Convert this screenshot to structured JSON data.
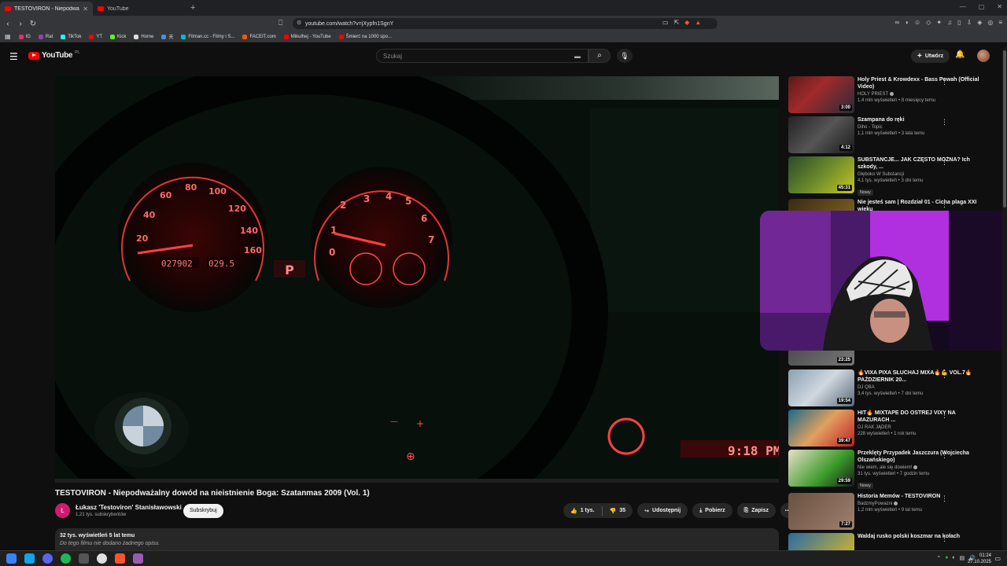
{
  "browser": {
    "tabs": [
      {
        "label": "TESTOVIRON - Niepodważaln",
        "active": true
      },
      {
        "label": "YouTube",
        "active": false
      }
    ],
    "url": "youtube.com/watch?v=jXypfn1SgnY",
    "bookmarks": [
      {
        "label": "IG",
        "color": "#e1306c"
      },
      {
        "label": "Rat",
        "color": "#8e44ad"
      },
      {
        "label": "TikTok",
        "color": "#25f4ee"
      },
      {
        "label": "YT",
        "color": "#ff0000"
      },
      {
        "label": "Kick",
        "color": "#53fc18"
      },
      {
        "label": "Home",
        "color": "#dddddd"
      },
      {
        "label": "天",
        "color": "#4a90d9"
      },
      {
        "label": "Filman.cc - Filmy i S...",
        "color": "#00bcd4"
      },
      {
        "label": "FACEIT.com",
        "color": "#ff5500"
      },
      {
        "label": "Mikulhej - YouTube",
        "color": "#ff0000"
      },
      {
        "label": "Śmierć na 1000 spo...",
        "color": "#ff0000"
      }
    ]
  },
  "header": {
    "logo": "YouTube",
    "country": "PL",
    "search_placeholder": "Szukaj",
    "create_label": "Utwórz"
  },
  "video": {
    "title": "TESTOVIRON - Niepodważalny dowód na nieistnienie Boga: Szatanmas 2009 (Vol. 1)",
    "channel": "Łukasz 'Testoviron' Stanisławowski",
    "channel_initial": "Ł",
    "subscribers": "1,21 tys. subskrybentów",
    "subscribe_label": "Subskrybuj",
    "likes": "1 tys.",
    "dislikes": "35",
    "share_label": "Udostępnij",
    "download_label": "Pobierz",
    "save_label": "Zapisz",
    "views_meta": "32 tys. wyświetleń  5 lat temu",
    "description": "Do tego filmu nie dodano żadnego opisu.",
    "odometer": "027902",
    "trip": "029.5",
    "gear": "P",
    "clock": "9:18 PM"
  },
  "sidebar": {
    "items": [
      {
        "title": "Holy Priest & Krowdexx - Bass Powah (Official Video)",
        "channel": "HOLY PRIEST",
        "meta": "1,4 mln wyświetleń • 8 miesięcy temu",
        "duration": "3:00",
        "new": ""
      },
      {
        "title": "Szampana do ręki",
        "channel": "Diho - Topic",
        "meta": "1,1 mln wyświetleń • 3 lata temu",
        "duration": "4:12",
        "new": ""
      },
      {
        "title": "SUBSTANCJE... JAK CZĘSTO MOŻNA? Ich szkody, ...",
        "channel": "Głęboko W Substancji",
        "meta": "4,1 tys. wyświetleń • 3 dni temu",
        "duration": "45:31",
        "new": "Nowy"
      },
      {
        "title": "Nie jesteś sam | Rozdział 01 - Cicha plaga XXI wieku",
        "channel": "",
        "meta": "",
        "duration": "",
        "new": ""
      },
      {
        "title": "",
        "channel": "",
        "meta": "",
        "duration": "23:25",
        "new": ""
      },
      {
        "title": "🔥VIXA PIXA SŁUCHAJ MIXA🔥💪 VOL.7🔥 PAŹDZIERNIK 20...",
        "channel": "DJ QBA",
        "meta": "3,4 tys. wyświetleń • 7 dni temu",
        "duration": "19:54",
        "new": ""
      },
      {
        "title": "HIT🔥 MIXTAPE DO OSTREJ VIXY NA MAZURACH ...",
        "channel": "DJ RAK JĄDER",
        "meta": "228 wyświetleń • 1 rok temu",
        "duration": "39:47",
        "new": ""
      },
      {
        "title": "Przeklęty Przypadek Jaszczura (Wojciecha Olszańskiego)",
        "channel": "Nie wiem, ale się dowiem!",
        "meta": "31 tys. wyświetleń • 7 godzin temu",
        "duration": "29:59",
        "new": "Nowy"
      },
      {
        "title": "Historia Memów - TESTOVIRON",
        "channel": "BadzmyPowazni",
        "meta": "1,2 mln wyświetleń • 9 lat temu",
        "duration": "7:27",
        "new": ""
      },
      {
        "title": "Waldaj rusko polski koszmar na kołach",
        "channel": "",
        "meta": "",
        "duration": "",
        "new": ""
      }
    ]
  },
  "taskbar": {
    "time": "01:24",
    "date": "27.10.2025"
  },
  "colors": {
    "accent": "#ff0000",
    "gauge": "#ff3a3a"
  }
}
